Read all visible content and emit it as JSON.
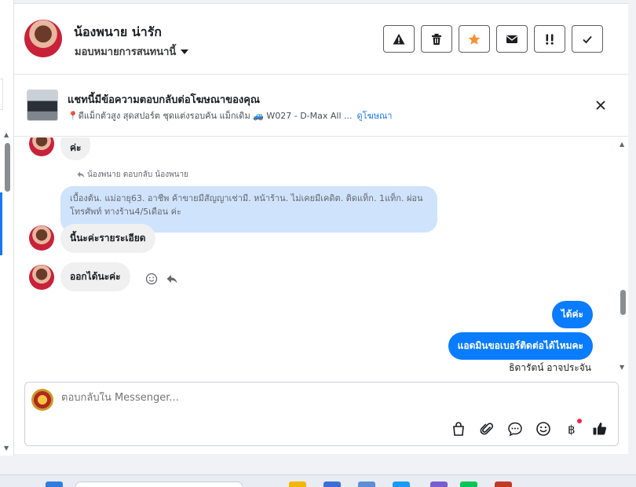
{
  "header": {
    "contact_name": "น้องพนาย น่ารัก",
    "assign_label": "มอบหมายการสนทนานี้"
  },
  "toolbar": {
    "buttons": [
      "warning-icon",
      "trash-icon",
      "star-icon",
      "envelope-icon",
      "important-icon",
      "check-icon"
    ],
    "star_color": "#f7923a"
  },
  "ad": {
    "title": "แชทนี้มีข้อความตอบกลับต่อโฆษณาของคุณ",
    "description": "📍ดีแม็กตัวสูง สุดสปอร์ต ชุดแต่งรอบคัน แม็กเดิม 🚙 W027 - D-Max All ...",
    "link": "ดูโฆษณา"
  },
  "chat": {
    "messages": [
      {
        "direction": "in",
        "text": "ค่ะ"
      },
      {
        "direction": "in",
        "reply_label": "น้องพนาย ตอบกลับ น้องพนาย",
        "quoted": "เบื้องต้น. แม่อายุ63. อาชีพ ค้าขายมีสัญญาเช่ามี. หน้าร้าน. ไม่เคยมีเคดิต. ติดแท็ก. 1แท็ก. ผ่อน โทรศัพท์ ทางร้าน4/5เดือน ค่ะ",
        "text": "นี้นะค่ะรายระเอียด"
      },
      {
        "direction": "in",
        "text": "ออกได้นะค่ะ"
      },
      {
        "direction": "out",
        "text": "ได้ค่ะ"
      },
      {
        "direction": "out",
        "text": "แอดมินขอเบอร์ติดต่อได้ไหมคะ",
        "sender": "ธิดารัตน์ อาจประจัน"
      }
    ]
  },
  "composer": {
    "placeholder": "ตอบกลับใน Messenger...",
    "tools": [
      "shopping-bag-icon",
      "paperclip-icon",
      "chat-bubble-icon",
      "smiley-icon",
      "baht-icon",
      "thumbs-up-icon"
    ]
  },
  "colors": {
    "accent": "#0a7cff",
    "quoted_bg": "#cfe3fc",
    "link": "#1877f2"
  }
}
